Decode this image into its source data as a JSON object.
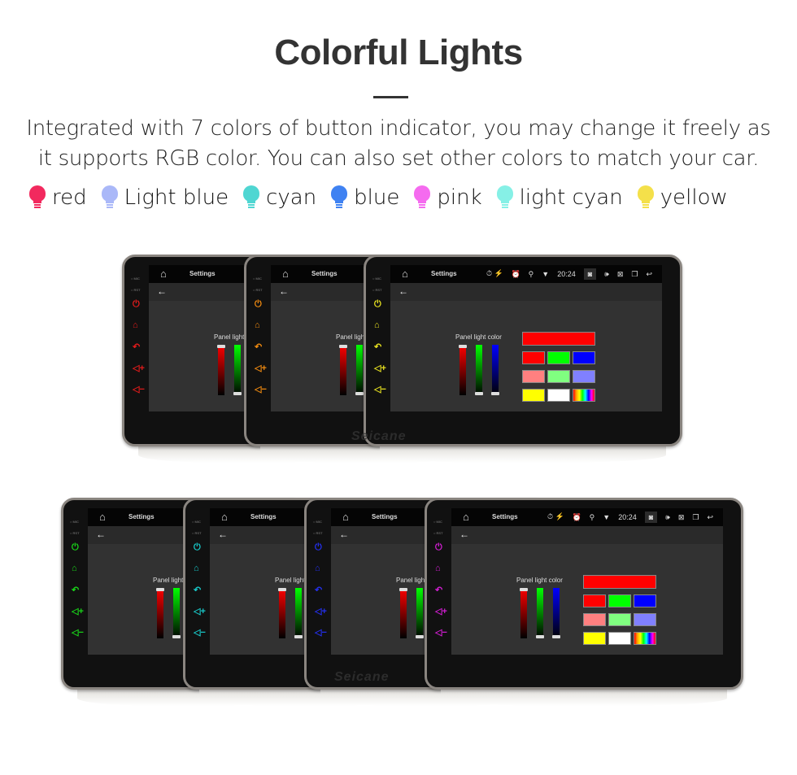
{
  "header": {
    "title": "Colorful Lights",
    "description_line1": "Integrated with 7 colors of button indicator, you may change it freely as",
    "description_line2": "it supports RGB color. You can also set other colors to match your car."
  },
  "legend": [
    {
      "label": "red",
      "color": "#f2295e"
    },
    {
      "label": "Light blue",
      "color": "#aab8f8"
    },
    {
      "label": "cyan",
      "color": "#4fd6d2"
    },
    {
      "label": "blue",
      "color": "#3f82f2"
    },
    {
      "label": "pink",
      "color": "#f56bef"
    },
    {
      "label": "light cyan",
      "color": "#86f0e6"
    },
    {
      "label": "yellow",
      "color": "#f4e04a"
    }
  ],
  "device": {
    "screen_title": "Settings",
    "clock": "20:24",
    "mic_label": "MIC",
    "rst_label": "RST",
    "panel_label": "Panel light color",
    "panel_label_cropped": "Panel light",
    "brand_watermark": "Seicane",
    "status_icons": [
      "alarm-icon",
      "location-icon",
      "wifi-icon"
    ],
    "nav_icons": [
      "camera-icon",
      "volume-icon",
      "close-app-icon",
      "recent-apps-icon",
      "back-icon"
    ],
    "side_buttons": [
      "power-icon",
      "home-icon",
      "back-icon",
      "volume-up-icon",
      "volume-down-icon"
    ],
    "rgb_sliders": {
      "red": 1.0,
      "green": 0.0,
      "blue": 0.0
    },
    "swatches": [
      "#ff0000",
      "#ff0000",
      "#00ff00",
      "#0000ff",
      "#ff8080",
      "#80ff80",
      "#8080ff",
      "#ffff00",
      "#ffffff",
      "rainbow"
    ]
  },
  "units_top": [
    {
      "button_color": "#e31b1b"
    },
    {
      "button_color": "#f08a10"
    },
    {
      "button_color": "#e6e020"
    }
  ],
  "units_bottom": [
    {
      "button_color": "#19d619"
    },
    {
      "button_color": "#18c8c8"
    },
    {
      "button_color": "#2430ee"
    },
    {
      "button_color": "#d21ed2"
    }
  ]
}
